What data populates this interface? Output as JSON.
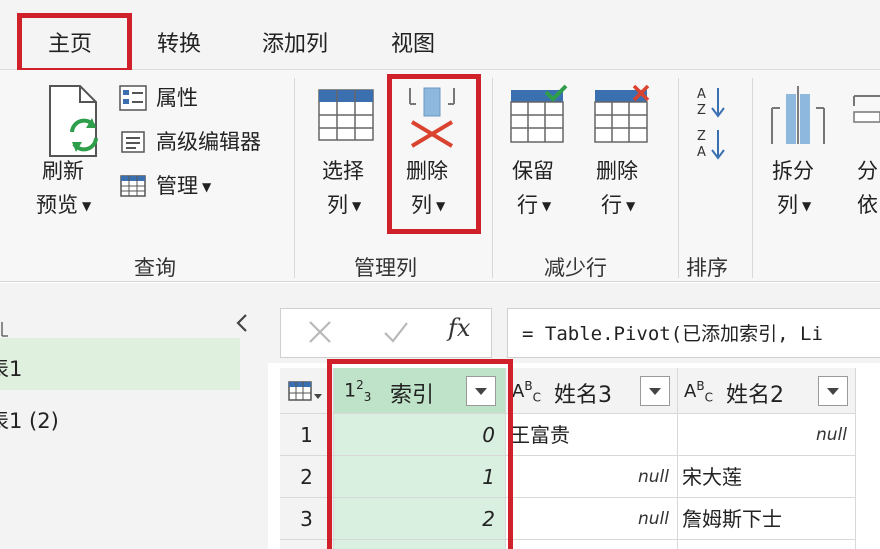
{
  "menu": {
    "tabs": [
      "主页",
      "转换",
      "添加列",
      "视图"
    ]
  },
  "ribbon": {
    "query": {
      "refresh_line1": "刷新",
      "refresh_line2": "预览",
      "properties": "属性",
      "advanced_editor": "高级编辑器",
      "manage": "管理",
      "group_label": "查询"
    },
    "manage_columns": {
      "choose_line1": "选择",
      "choose_line2": "列",
      "remove_line1": "删除",
      "remove_line2": "列",
      "group_label": "管理列"
    },
    "reduce_rows": {
      "keep_line1": "保留",
      "keep_line2": "行",
      "remove_line1": "删除",
      "remove_line2": "行",
      "group_label": "减少行"
    },
    "sort": {
      "group_label": "排序"
    },
    "split": {
      "line1": "拆分",
      "line2": "列",
      "partial_line1": "分",
      "partial_line2": "依"
    }
  },
  "left_panel": {
    "items": [
      "表1",
      "表1 (2)"
    ]
  },
  "formula_bar": {
    "fx_label": "fx",
    "formula": "= Table.Pivot(已添加索引, Li"
  },
  "grid": {
    "columns": [
      {
        "type": "123",
        "name": "索引"
      },
      {
        "type": "ABC",
        "name": "姓名3"
      },
      {
        "type": "ABC",
        "name": "姓名2"
      }
    ],
    "rows": [
      {
        "n": "1",
        "idx": "0",
        "c2": "王富贵",
        "c3": "null"
      },
      {
        "n": "2",
        "idx": "1",
        "c2": "null",
        "c3": "宋大莲"
      },
      {
        "n": "3",
        "idx": "2",
        "c2": "null",
        "c3": "詹姆斯下士"
      }
    ]
  },
  "colors": {
    "highlight_red": "#d0202a",
    "selected_column": "#d9efdf",
    "selected_header": "#bfe3c8"
  }
}
